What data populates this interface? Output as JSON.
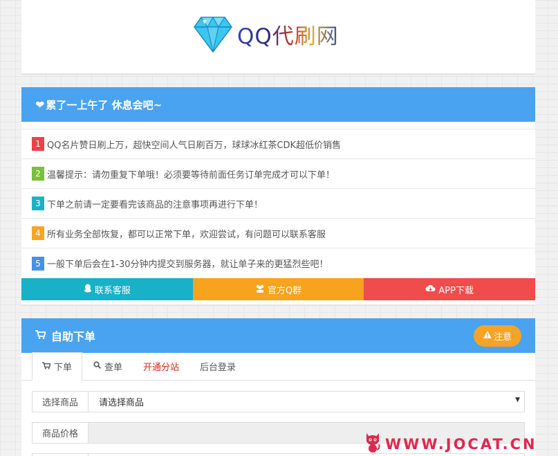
{
  "logo": {
    "text": "QQ代刷网",
    "icon": "diamond-icon"
  },
  "notice": {
    "title": "累了一上午了 休息会吧~",
    "title_icon": "heart-icon",
    "items": [
      {
        "num": "1",
        "color": "#e8424c",
        "text": "QQ名片赞日刷上万，超快空间人气日刷百万，球球冰红茶CDK超低价销售"
      },
      {
        "num": "2",
        "color": "#7bbf3a",
        "text": "温馨提示：请勿重复下单哦！必须要等待前面任务订单完成才可以下单！"
      },
      {
        "num": "3",
        "color": "#1eb1c5",
        "text": "下单之前请一定要看完该商品的注意事项再进行下单！"
      },
      {
        "num": "4",
        "color": "#f5a623",
        "text": "所有业务全部恢复，都可以正常下单，欢迎尝试，有问题可以联系客服"
      },
      {
        "num": "5",
        "color": "#4a90e2",
        "text": "一般下单后会在1-30分钟内提交到服务器，就让单子来的更猛烈些吧！"
      }
    ],
    "buttons": [
      {
        "label": "联系客服",
        "icon": "qq-penguin-icon",
        "color": "#18b1c8"
      },
      {
        "label": "官方Q群",
        "icon": "users-icon",
        "color": "#f7a31d"
      },
      {
        "label": "APP下载",
        "icon": "cloud-download-icon",
        "color": "#f04c4c"
      }
    ]
  },
  "order": {
    "title": "自助下单",
    "title_icon": "cart-icon",
    "notice_button": "注意",
    "tabs": [
      {
        "label": "下单",
        "icon": "cart-icon"
      },
      {
        "label": "查单",
        "icon": "search-icon"
      },
      {
        "label": "开通分站",
        "icon": ""
      },
      {
        "label": "后台登录",
        "icon": ""
      }
    ],
    "product_label": "选择商品",
    "product_value": "请选择商品",
    "price_label": "商品价格",
    "price_value": ""
  },
  "watermark": {
    "text": "WWW.JOCAT.CN",
    "icon": "cat-icon"
  }
}
